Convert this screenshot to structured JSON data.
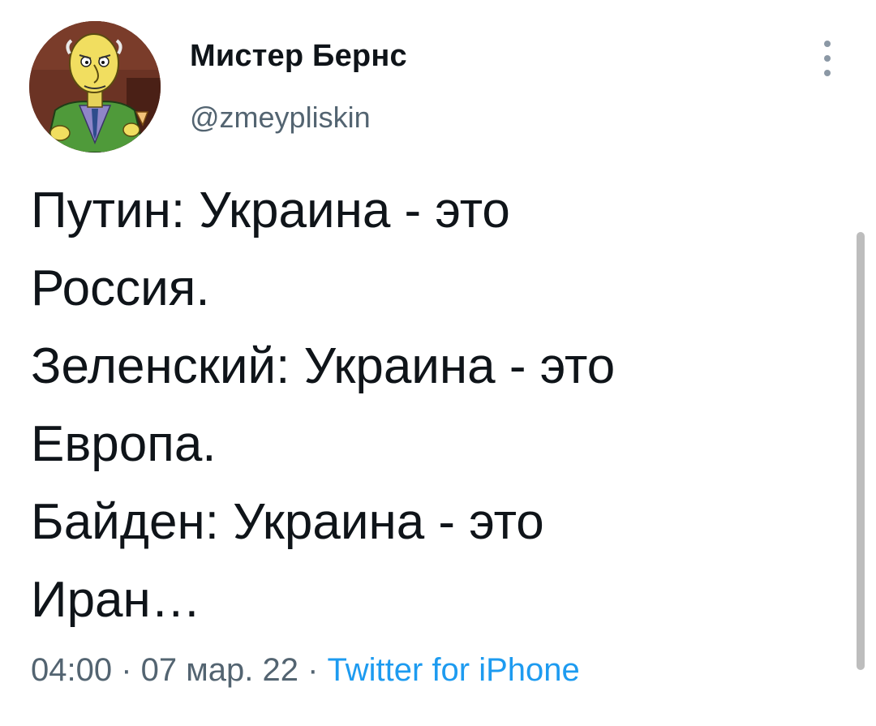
{
  "author": {
    "display_name": "Мистер Бернс",
    "handle": "@zmeypliskin",
    "avatar_icon": "mr-burns-avatar"
  },
  "menu": {
    "icon": "vertical-ellipsis-icon"
  },
  "tweet": {
    "lines": [
      "Путин: Украина - это",
      "Россия.",
      "Зеленский: Украина - это",
      "Европа.",
      "Байден: Украина - это",
      "Иран…"
    ]
  },
  "meta": {
    "time": "04:00",
    "separator": " · ",
    "date": "07 мар. 22",
    "source": "Twitter for iPhone"
  },
  "colors": {
    "text": "#0f1419",
    "secondary": "#536471",
    "link": "#1d9bf0"
  }
}
